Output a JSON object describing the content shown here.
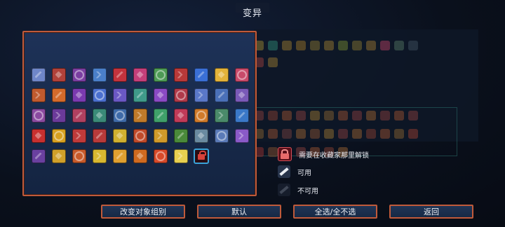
{
  "title": "变异",
  "legend": {
    "locked": "需要在收藏家那里解锁",
    "available": "可用",
    "unavailable": "不可用"
  },
  "buttons": {
    "change_group": "改变对象组别",
    "default": "默认",
    "select_all": "全选/全不选",
    "back": "返回"
  },
  "mutation_icons": [
    {
      "name": "mutation-icon-1",
      "color": "#6f86c8"
    },
    {
      "name": "mutation-icon-2",
      "color": "#b0413a"
    },
    {
      "name": "mutation-icon-3",
      "color": "#7a3ea0"
    },
    {
      "name": "mutation-icon-4",
      "color": "#4a7fc9"
    },
    {
      "name": "mutation-icon-5",
      "color": "#c3333d"
    },
    {
      "name": "mutation-icon-6",
      "color": "#c43f7a"
    },
    {
      "name": "mutation-icon-7",
      "color": "#4d9a55"
    },
    {
      "name": "mutation-icon-8",
      "color": "#b83939"
    },
    {
      "name": "mutation-icon-9",
      "color": "#3a6fd6"
    },
    {
      "name": "mutation-icon-10",
      "color": "#e3b23a"
    },
    {
      "name": "mutation-icon-11",
      "color": "#c84a6a"
    },
    {
      "name": "mutation-icon-12",
      "color": "#c05a2e"
    },
    {
      "name": "mutation-icon-13",
      "color": "#d46a2b"
    },
    {
      "name": "mutation-icon-14",
      "color": "#7a3ab0"
    },
    {
      "name": "mutation-icon-15",
      "color": "#4a6fcf"
    },
    {
      "name": "mutation-icon-16",
      "color": "#6a58c4"
    },
    {
      "name": "mutation-icon-17",
      "color": "#3f9a8a"
    },
    {
      "name": "mutation-icon-18",
      "color": "#8a4ac4"
    },
    {
      "name": "mutation-icon-19",
      "color": "#b03a4a"
    },
    {
      "name": "mutation-icon-20",
      "color": "#5a78c8"
    },
    {
      "name": "mutation-icon-21",
      "color": "#4a70b8"
    },
    {
      "name": "mutation-icon-22",
      "color": "#7a5ab8"
    },
    {
      "name": "mutation-icon-23",
      "color": "#8a4aa0"
    },
    {
      "name": "mutation-icon-24",
      "color": "#6a3a9a"
    },
    {
      "name": "mutation-icon-25",
      "color": "#b04060"
    },
    {
      "name": "mutation-icon-26",
      "color": "#3a8a78"
    },
    {
      "name": "mutation-icon-27",
      "color": "#3e6aa8"
    },
    {
      "name": "mutation-icon-28",
      "color": "#c07a2a"
    },
    {
      "name": "mutation-icon-29",
      "color": "#3fa06a"
    },
    {
      "name": "mutation-icon-30",
      "color": "#c03a58"
    },
    {
      "name": "mutation-icon-31",
      "color": "#d07a2a"
    },
    {
      "name": "mutation-icon-32",
      "color": "#4a8a6a"
    },
    {
      "name": "mutation-icon-33",
      "color": "#3a78c8"
    },
    {
      "name": "mutation-icon-34",
      "color": "#c83030"
    },
    {
      "name": "mutation-icon-35",
      "color": "#d8a020"
    },
    {
      "name": "mutation-icon-36",
      "color": "#c03a3a"
    },
    {
      "name": "mutation-icon-37",
      "color": "#b83a3a"
    },
    {
      "name": "mutation-icon-38",
      "color": "#d0b030"
    },
    {
      "name": "mutation-icon-39",
      "color": "#c04a2a"
    },
    {
      "name": "mutation-icon-40",
      "color": "#d09a2a"
    },
    {
      "name": "mutation-icon-41",
      "color": "#4a8a3a"
    },
    {
      "name": "mutation-icon-42",
      "color": "#6a8aa0"
    },
    {
      "name": "mutation-icon-43",
      "color": "#5a7ab8"
    },
    {
      "name": "mutation-icon-44",
      "color": "#8a5ac8"
    },
    {
      "name": "mutation-icon-45",
      "color": "#6a40a0"
    },
    {
      "name": "mutation-icon-46",
      "color": "#d0a02a"
    },
    {
      "name": "mutation-icon-47",
      "color": "#c85a2a"
    },
    {
      "name": "mutation-icon-48",
      "color": "#d8b830"
    },
    {
      "name": "mutation-icon-49",
      "color": "#e0a030"
    },
    {
      "name": "mutation-icon-50",
      "color": "#d06a20"
    },
    {
      "name": "mutation-icon-51",
      "color": "#d84a2a"
    },
    {
      "name": "mutation-icon-52",
      "color": "#e8d050"
    }
  ]
}
